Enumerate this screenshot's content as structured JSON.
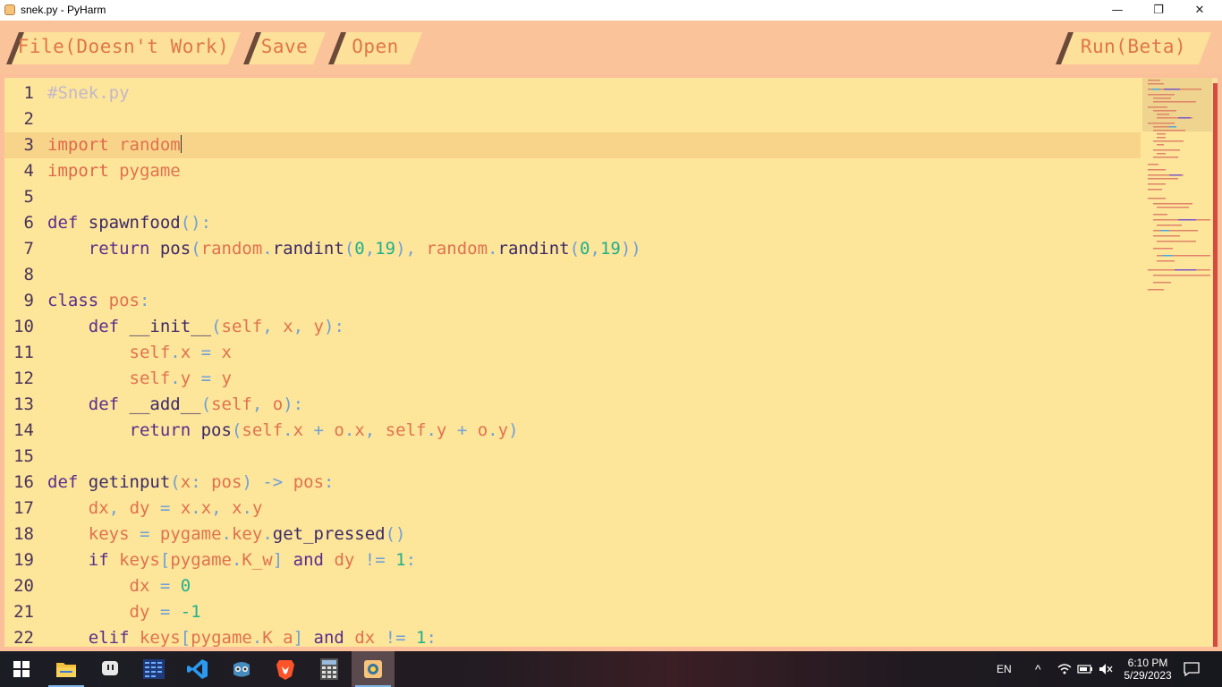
{
  "window": {
    "title": "snek.py - PyHarm",
    "minimize_label": "—",
    "maximize_label": "❐",
    "close_label": "✕"
  },
  "toolbar": {
    "file_label": "File(Doesn't Work)",
    "save_label": "Save",
    "open_label": "Open",
    "run_label": "Run(Beta)"
  },
  "editor": {
    "line_numbers": [
      "1",
      "2",
      "3",
      "4",
      "5",
      "6",
      "7",
      "8",
      "9",
      "10",
      "11",
      "12",
      "13",
      "14",
      "15",
      "16",
      "17",
      "18",
      "19",
      "20",
      "21",
      "22"
    ],
    "current_line": "3",
    "lines": [
      "#Snek.py",
      "",
      "import random",
      "import pygame",
      "",
      "def spawnfood():",
      "    return pos(random.randint(0,19), random.randint(0,19))",
      "",
      "class pos:",
      "    def __init__(self, x, y):",
      "        self.x = x",
      "        self.y = y",
      "    def __add__(self, o):",
      "        return pos(self.x + o.x, self.y + o.y)",
      "",
      "def getinput(x: pos) -> pos:",
      "    dx, dy = x.x, x.y",
      "    keys = pygame.key.get_pressed()",
      "    if keys[pygame.K_w] and dy != 1:",
      "        dx = 0",
      "        dy = -1",
      "    elif keys[pygame.K_a] and dx != 1:"
    ]
  },
  "taskbar": {
    "apps": [
      "windows-start",
      "file-explorer",
      "twitch",
      "task-grid",
      "vs-code",
      "godot",
      "brave",
      "calculator",
      "pyharm"
    ],
    "active_app": "pyharm",
    "language": "EN",
    "time": "6:10 PM",
    "date": "5/29/2023"
  },
  "colors": {
    "toolbar_bg": "#fbc39a",
    "editor_bg": "#fde59a",
    "keyword": "#5a2d8c",
    "import_keyword": "#e0684a",
    "number": "#1fb08a",
    "punctuation": "#6fa0d8"
  }
}
